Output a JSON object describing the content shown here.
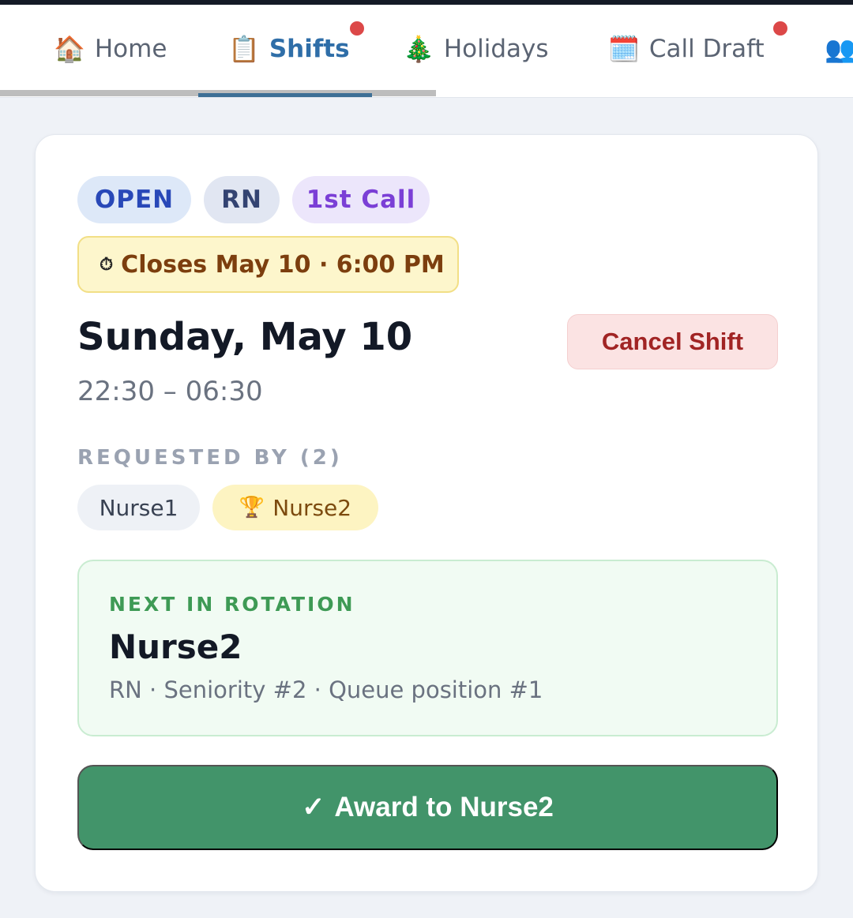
{
  "nav": {
    "tabs": [
      {
        "icon": "🏠",
        "label": "Home"
      },
      {
        "icon": "📋",
        "label": "Shifts"
      },
      {
        "icon": "🎄",
        "label": "Holidays"
      },
      {
        "icon": "🗓️",
        "label": "Call Draft"
      },
      {
        "icon": "👥",
        "label": ""
      }
    ],
    "active_tab": "Shifts"
  },
  "shift": {
    "status_badge": "OPEN",
    "role_badge": "RN",
    "call_badge": "1st Call",
    "closes_icon": "⏱",
    "closes_text": "Closes May 10 · 6:00 PM",
    "date": "Sunday, May 10",
    "time_range": "22:30 – 06:30",
    "cancel_label": "Cancel Shift"
  },
  "requests": {
    "label": "REQUESTED BY (2)",
    "nurses": [
      {
        "name": "Nurse1"
      },
      {
        "icon": "🏆",
        "name": "Nurse2"
      }
    ]
  },
  "rotation": {
    "label": "NEXT IN ROTATION",
    "name": "Nurse2",
    "meta": "RN · Seniority #2 · Queue position #1"
  },
  "award": {
    "icon": "✓",
    "label": "Award to Nurse2"
  },
  "colors": {
    "accent": "#2f6ea8",
    "award_green": "#42946a",
    "cancel_red": "#a12424",
    "notification_dot": "#dc4848"
  }
}
